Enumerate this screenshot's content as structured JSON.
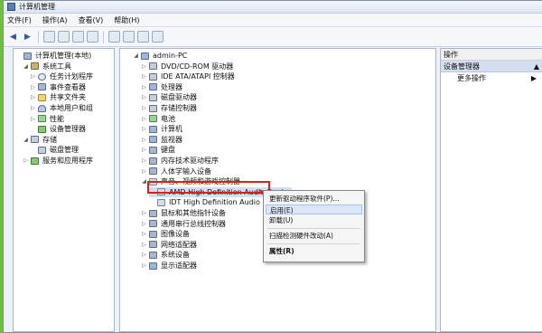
{
  "window": {
    "title": "计算机管理"
  },
  "menubar": [
    "文件(F)",
    "操作(A)",
    "查看(V)",
    "帮助(H)"
  ],
  "left_tree": [
    {
      "label": "计算机管理(本地)",
      "icon": "computer-management-icon",
      "level": 0,
      "expander": ""
    },
    {
      "label": "系统工具",
      "icon": "tools-icon",
      "level": 1,
      "expander": "◢"
    },
    {
      "label": "任务计划程序",
      "icon": "clock-icon",
      "level": 2,
      "expander": "▷"
    },
    {
      "label": "事件查看器",
      "icon": "event-viewer-icon",
      "level": 2,
      "expander": "▷"
    },
    {
      "label": "共享文件夹",
      "icon": "folder-icon",
      "level": 2,
      "expander": "▷"
    },
    {
      "label": "本地用户和组",
      "icon": "users-icon",
      "level": 2,
      "expander": "▷"
    },
    {
      "label": "性能",
      "icon": "performance-icon",
      "level": 2,
      "expander": "▷"
    },
    {
      "label": "设备管理器",
      "icon": "device-manager-icon",
      "level": 2,
      "expander": ""
    },
    {
      "label": "存储",
      "icon": "storage-icon",
      "level": 1,
      "expander": "◢"
    },
    {
      "label": "磁盘管理",
      "icon": "disk-icon",
      "level": 2,
      "expander": ""
    },
    {
      "label": "服务和应用程序",
      "icon": "services-icon",
      "level": 1,
      "expander": "▷"
    }
  ],
  "device_tree": [
    {
      "label": "admin-PC",
      "icon": "computer-icon",
      "level": 0,
      "expander": "◢"
    },
    {
      "label": "DVD/CD-ROM 驱动器",
      "icon": "dvd-icon",
      "level": 1,
      "expander": "▷"
    },
    {
      "label": "IDE ATA/ATAPI 控制器",
      "icon": "ide-icon",
      "level": 1,
      "expander": "▷"
    },
    {
      "label": "处理器",
      "icon": "processor-icon",
      "level": 1,
      "expander": "▷"
    },
    {
      "label": "磁盘驱动器",
      "icon": "disk-drive-icon",
      "level": 1,
      "expander": "▷"
    },
    {
      "label": "存储控制器",
      "icon": "storage-controller-icon",
      "level": 1,
      "expander": "▷"
    },
    {
      "label": "电池",
      "icon": "battery-icon",
      "level": 1,
      "expander": "▷"
    },
    {
      "label": "计算机",
      "icon": "computer-icon",
      "level": 1,
      "expander": "▷"
    },
    {
      "label": "监视器",
      "icon": "monitor-icon",
      "level": 1,
      "expander": "▷"
    },
    {
      "label": "键盘",
      "icon": "keyboard-icon",
      "level": 1,
      "expander": "▷"
    },
    {
      "label": "内存技术驱动程序",
      "icon": "memory-icon",
      "level": 1,
      "expander": "▷"
    },
    {
      "label": "人体学输入设备",
      "icon": "hid-icon",
      "level": 1,
      "expander": "▷"
    },
    {
      "label": "声音、视频和游戏控制器",
      "icon": "sound-icon",
      "level": 1,
      "expander": "◢"
    },
    {
      "label": "AMD High Definition Audio Device",
      "icon": "audio-device-icon",
      "level": 2,
      "expander": "",
      "selected": true
    },
    {
      "label": "IDT High Definition Audio COD",
      "icon": "audio-device-icon",
      "level": 2,
      "expander": ""
    },
    {
      "label": "鼠标和其他指针设备",
      "icon": "mouse-icon",
      "level": 1,
      "expander": "▷"
    },
    {
      "label": "通用串行总线控制器",
      "icon": "usb-icon",
      "level": 1,
      "expander": "▷"
    },
    {
      "label": "图像设备",
      "icon": "camera-icon",
      "level": 1,
      "expander": "▷"
    },
    {
      "label": "网络适配器",
      "icon": "network-icon",
      "level": 1,
      "expander": "▷"
    },
    {
      "label": "系统设备",
      "icon": "system-device-icon",
      "level": 1,
      "expander": "▷"
    },
    {
      "label": "显示适配器",
      "icon": "display-adapter-icon",
      "level": 1,
      "expander": "▷"
    }
  ],
  "actions_pane": {
    "header": "操作",
    "section": "设备管理器",
    "more": "更多操作"
  },
  "context_menu": [
    {
      "label": "更新驱动程序软件(P)...",
      "highlighted": false
    },
    {
      "label": "启用(E)",
      "highlighted": true
    },
    {
      "label": "卸载(U)",
      "highlighted": false
    },
    {
      "sep": true
    },
    {
      "label": "扫描检测硬件改动(A)",
      "highlighted": false
    },
    {
      "sep": true
    },
    {
      "label": "属性(R)",
      "highlighted": false,
      "bold": true
    }
  ],
  "colors": {
    "highlight_box": "#d9211b",
    "menu_highlight": "#dbe7f8"
  }
}
